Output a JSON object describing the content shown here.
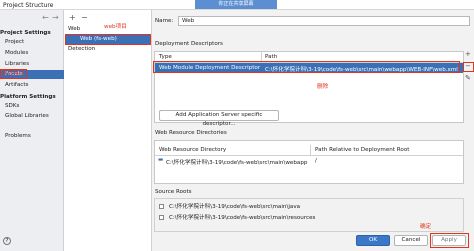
{
  "window": {
    "title": "Project Structure",
    "caption": "你正在共享屏幕"
  },
  "nav": {
    "back": "←",
    "forward": "→"
  },
  "sidebar": {
    "section1": "Project Settings",
    "items1": [
      "Project",
      "Modules",
      "Libraries",
      "Facets",
      "Artifacts"
    ],
    "section2": "Platform Settings",
    "items2": [
      "SDKs",
      "Global Libraries"
    ],
    "problems": "Problems"
  },
  "facets": {
    "toolbar": {
      "add": "+",
      "remove": "−"
    },
    "group": "Web",
    "item": "Web (fs-web)",
    "detection": "Detection"
  },
  "annotations": {
    "web_project": "web项目",
    "project_feature": "项目特征",
    "delete": "删除",
    "confirm": "确定"
  },
  "form": {
    "name_label": "Name:",
    "name_value": "Web",
    "deploy_title": "Deployment Descriptors",
    "col_type": "Type",
    "col_path": "Path",
    "row_type": "Web Module Deployment Descriptor",
    "row_path": "C:\\怀化学院计科\\3-19\\code\\fs-web\\src\\main\\webapp\\WEB-INF\\web.xml",
    "add_server_btn": "Add Application Server specific descriptor...",
    "resource_title": "Web Resource Directories",
    "res_col1": "Web Resource Directory",
    "res_col2": "Path Relative to Deployment Root",
    "res_row_dir": "C:\\怀化学院计科\\3-19\\code\\fs-web\\src\\main\\webapp",
    "res_row_rel": "/",
    "source_title": "Source Roots",
    "sources": [
      "C:\\怀化学院计科\\3-19\\code\\fs-web\\src\\main\\java",
      "C:\\怀化学院计科\\3-19\\code\\fs-web\\src\\main\\resources"
    ],
    "side_add": "+",
    "side_remove": "−",
    "side_edit": "✎"
  },
  "footer": {
    "help": "?",
    "ok": "OK",
    "cancel": "Cancel",
    "apply": "Apply"
  }
}
